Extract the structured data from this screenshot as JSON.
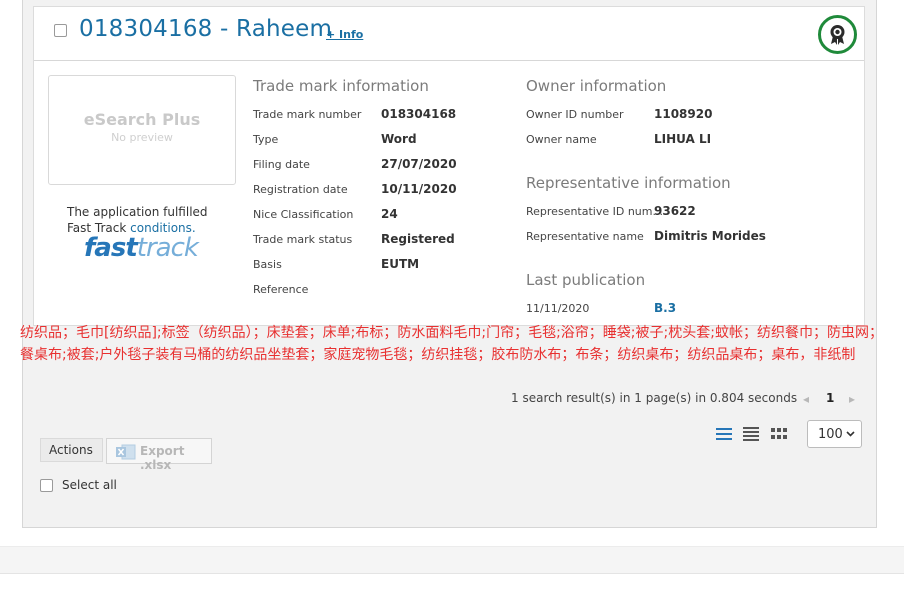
{
  "header": {
    "title": "018304168 - Raheem",
    "info_link": "+ Info",
    "badge_icon": "certificate-seal-icon"
  },
  "preview": {
    "title": "eSearch Plus",
    "subtitle": "No preview"
  },
  "fast_track": {
    "text_line1": "The application fulfilled",
    "text_line2_prefix": "Fast Track",
    "text_line2_link": "conditions.",
    "logo_fast": "fast",
    "logo_track": "track"
  },
  "trade_mark": {
    "heading": "Trade mark information",
    "rows": [
      {
        "label": "Trade mark number",
        "value": "018304168"
      },
      {
        "label": "Type",
        "value": "Word"
      },
      {
        "label": "Filing date",
        "value": "27/07/2020"
      },
      {
        "label": "Registration date",
        "value": "10/11/2020"
      },
      {
        "label": "Nice Classification",
        "value": "24"
      },
      {
        "label": "Trade mark status",
        "value": "Registered"
      },
      {
        "label": "Basis",
        "value": "EUTM"
      },
      {
        "label": "Reference",
        "value": ""
      }
    ]
  },
  "owner": {
    "heading": "Owner information",
    "rows": [
      {
        "label": "Owner ID number",
        "value": "1108920"
      },
      {
        "label": "Owner name",
        "value": "LIHUA LI"
      }
    ]
  },
  "representative": {
    "heading": "Representative information",
    "rows": [
      {
        "label": "Representative ID num...",
        "value": "93622"
      },
      {
        "label": "Representative name",
        "value": "Dimitris Morides"
      }
    ]
  },
  "publication": {
    "heading": "Last publication",
    "date": "11/11/2020",
    "section": "B.3"
  },
  "goods_text": "纺织品；毛巾[纺织品];标签（纺织品）；床垫套；床单;布标；防水面料毛巾;门帘；毛毯;浴帘；睡袋;被子;枕头套;蚊帐；纺织餐巾；防虫网；餐桌布;被套;户外毯子装有马桶的纺织品坐垫套；家庭宠物毛毯；纺织挂毯；胶布防水布；布条；纺织桌布；纺织品桌布；桌布，非纸制",
  "results": {
    "summary": "1 search result(s) in 1 page(s) in 0.804 seconds",
    "current_page": "1",
    "per_page": "100"
  },
  "toolbar": {
    "actions_label": "Actions",
    "export_label": "Export .xlsx",
    "select_all_label": "Select all"
  },
  "colors": {
    "link_blue": "#1a6fa3",
    "goods_red": "#e83030",
    "badge_green": "#1f8a3a"
  }
}
